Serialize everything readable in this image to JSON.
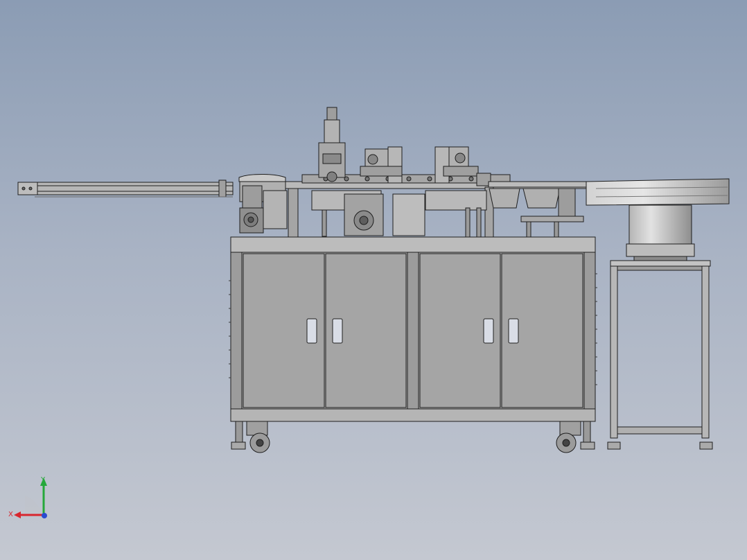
{
  "triad": {
    "x_label": "X",
    "y_label": "Y",
    "x_color": "#d8262e",
    "y_color": "#25a83a",
    "z_color": "#2a4bd0"
  },
  "colors": {
    "background_top": "#8b9cb4",
    "background_bottom": "#c4c8d1",
    "metal": "#a7a7a7",
    "metal_dark": "#8c8c8c",
    "outline": "#1e1e1e"
  }
}
